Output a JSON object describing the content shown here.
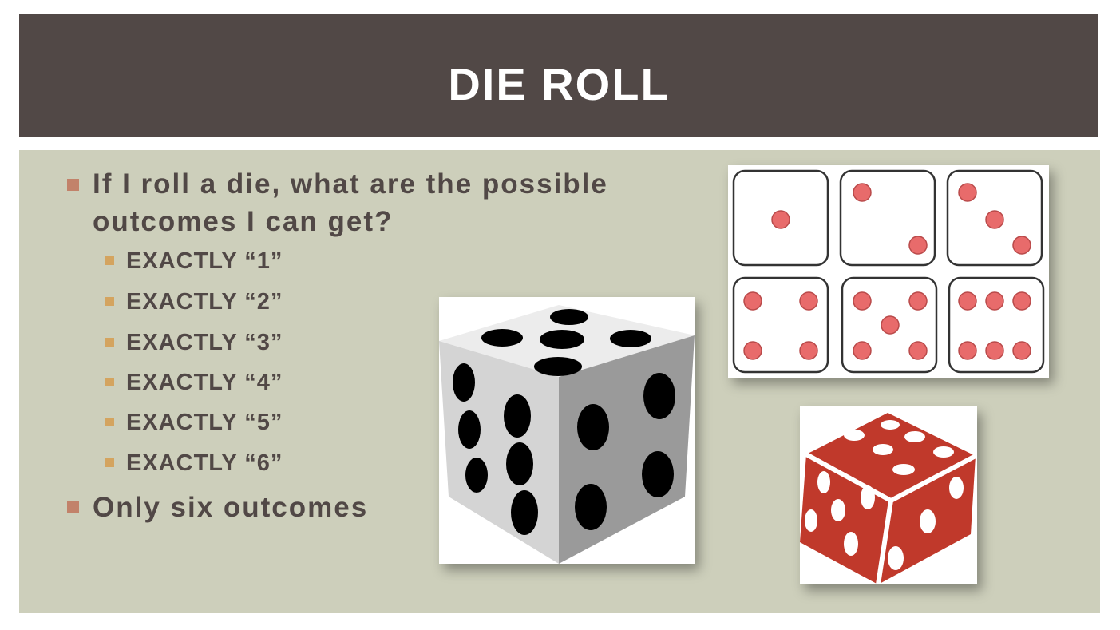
{
  "slide": {
    "title": "DIE ROLL",
    "question_line1": "If I roll a die, what are the possible",
    "question_line2": "outcomes I can get?",
    "outcomes": [
      "EXACTLY “1”",
      "EXACTLY “2”",
      "EXACTLY “3”",
      "EXACTLY “4”",
      "EXACTLY “5”",
      "EXACTLY “6”"
    ],
    "conclusion": "Only six outcomes"
  },
  "images": {
    "dice_faces": "six-dice-faces-image",
    "white_die": "white-die-image",
    "red_die": "red-die-image"
  },
  "colors": {
    "title_bar": "#514846",
    "content_bg": "#cdcfbb",
    "text": "#514846",
    "bullet_level1": "#c2826a",
    "bullet_level2": "#d4a45f",
    "pip": "#e86b6b",
    "red_die": "#c0392b"
  }
}
